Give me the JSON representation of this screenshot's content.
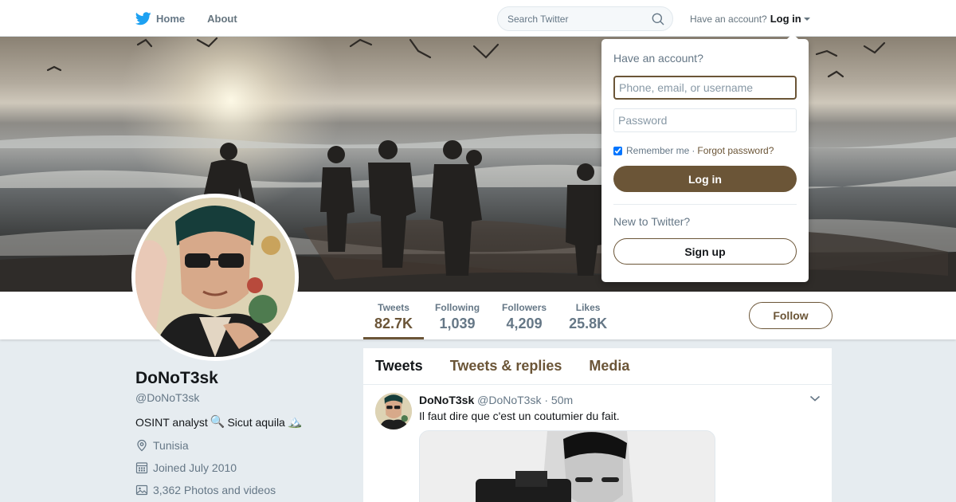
{
  "colors": {
    "accent": "#6b5537",
    "twitter_blue": "#1da1f2",
    "bg": "#e6ecf0"
  },
  "nav": {
    "home_label": "Home",
    "about_label": "About",
    "search_placeholder": "Search Twitter",
    "have_account_label": "Have an account?",
    "login_label": "Log in"
  },
  "login_dropdown": {
    "title": "Have an account?",
    "username_placeholder": "Phone, email, or username",
    "password_placeholder": "Password",
    "remember_label": "Remember me",
    "separator": "·",
    "forgot_label": "Forgot password?",
    "login_button": "Log in",
    "new_label": "New to Twitter?",
    "signup_button": "Sign up"
  },
  "profile": {
    "name": "DoNoT3sk",
    "handle": "@DoNoT3sk",
    "bio_text_1": "OSINT analyst",
    "bio_icon_1": "🔍",
    "bio_text_2": "Sicut aquila",
    "bio_icon_2": "🏔️",
    "location": "Tunisia",
    "joined": "Joined July 2010",
    "photos": "3,362 Photos and videos"
  },
  "stats": [
    {
      "label": "Tweets",
      "value": "82.7K"
    },
    {
      "label": "Following",
      "value": "1,039"
    },
    {
      "label": "Followers",
      "value": "4,209"
    },
    {
      "label": "Likes",
      "value": "25.8K"
    }
  ],
  "follow_button": "Follow",
  "timeline": {
    "tabs": [
      "Tweets",
      "Tweets & replies",
      "Media"
    ],
    "tweet": {
      "name": "DoNoT3sk",
      "handle": "@DoNoT3sk",
      "dot": "·",
      "time": "50m",
      "text": "Il faut dire que c'est un coutumier du fait."
    }
  }
}
